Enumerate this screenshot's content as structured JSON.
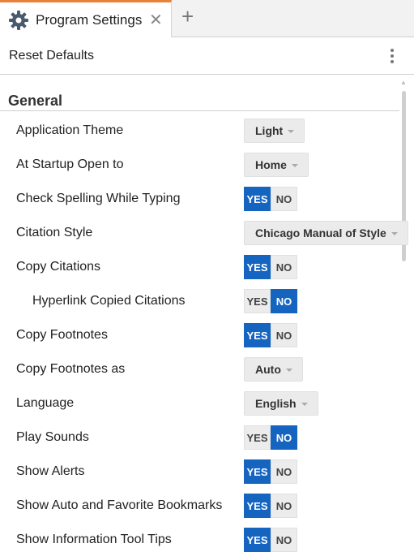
{
  "tab": {
    "title": "Program Settings",
    "close_glyph": "✕",
    "new_tab_glyph": "+",
    "icon": "gear-icon"
  },
  "toolbar": {
    "reset_label": "Reset Defaults",
    "more_icon": "more-vertical-icon"
  },
  "section": {
    "title": "General"
  },
  "colors": {
    "accent": "#1565c0",
    "tab_highlight": "#e8813a"
  },
  "settings": [
    {
      "label": "Application Theme",
      "type": "dropdown",
      "value": "Light"
    },
    {
      "label": "At Startup Open to",
      "type": "dropdown",
      "value": "Home"
    },
    {
      "label": "Check Spelling While Typing",
      "type": "toggle",
      "yes": "YES",
      "no": "NO",
      "value": "YES"
    },
    {
      "label": "Citation Style",
      "type": "dropdown",
      "value": "Chicago Manual of Style"
    },
    {
      "label": "Copy Citations",
      "type": "toggle",
      "yes": "YES",
      "no": "NO",
      "value": "YES"
    },
    {
      "label": "Hyperlink Copied Citations",
      "type": "toggle",
      "yes": "YES",
      "no": "NO",
      "value": "NO",
      "indent": true
    },
    {
      "label": "Copy Footnotes",
      "type": "toggle",
      "yes": "YES",
      "no": "NO",
      "value": "YES"
    },
    {
      "label": "Copy Footnotes as",
      "type": "dropdown",
      "value": "Auto"
    },
    {
      "label": "Language",
      "type": "dropdown",
      "value": "English"
    },
    {
      "label": "Play Sounds",
      "type": "toggle",
      "yes": "YES",
      "no": "NO",
      "value": "NO"
    },
    {
      "label": "Show Alerts",
      "type": "toggle",
      "yes": "YES",
      "no": "NO",
      "value": "YES"
    },
    {
      "label": "Show Auto and Favorite Bookmarks",
      "type": "toggle",
      "yes": "YES",
      "no": "NO",
      "value": "YES"
    },
    {
      "label": "Show Information Tool Tips",
      "type": "toggle",
      "yes": "YES",
      "no": "NO",
      "value": "YES"
    }
  ]
}
